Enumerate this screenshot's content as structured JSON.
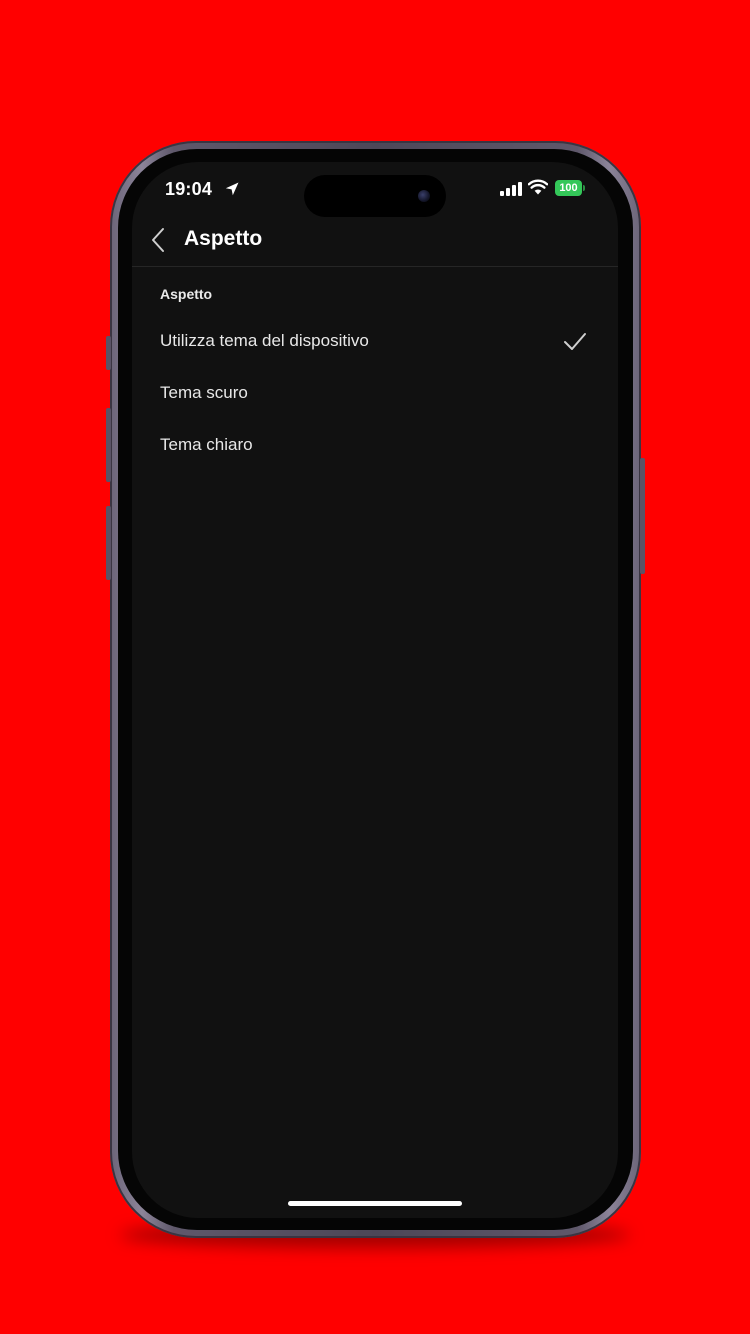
{
  "colors": {
    "background": "#ff0000",
    "screen": "#111111",
    "text": "#e8e8e8",
    "battery": "#34c759"
  },
  "status_bar": {
    "time": "19:04",
    "battery_level": "100",
    "icons": [
      "location-icon",
      "signal-icon",
      "wifi-icon",
      "battery-icon"
    ]
  },
  "nav": {
    "back_icon": "chevron-left-icon",
    "title": "Aspetto"
  },
  "settings": {
    "section_header": "Aspetto",
    "options": [
      {
        "label": "Utilizza tema del dispositivo",
        "selected": true
      },
      {
        "label": "Tema scuro",
        "selected": false
      },
      {
        "label": "Tema chiaro",
        "selected": false
      }
    ]
  }
}
